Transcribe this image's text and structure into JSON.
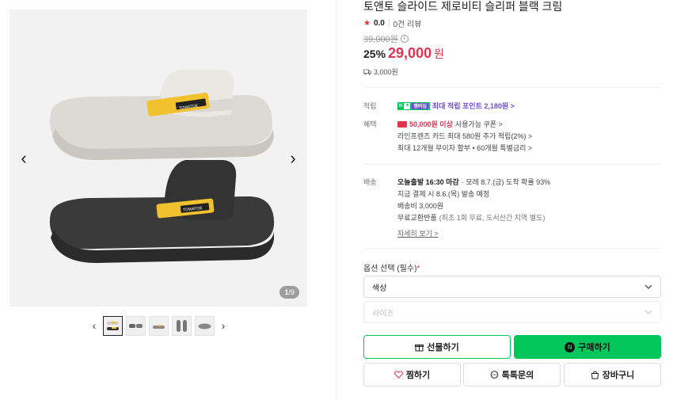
{
  "product": {
    "title": "토앤토 슬라이드 제로비티 슬리퍼 블랙 크림",
    "rating": "0.0",
    "review_count": "0건 리뷰",
    "original_price": "39,000원",
    "discount": "25%",
    "sale_price": "29,000",
    "currency": "원",
    "shipping_fee": "3,000원",
    "brand_mark": "TOWATOE"
  },
  "gallery": {
    "counter_current": "1",
    "counter_total": "/9",
    "prev_icon": "‹",
    "next_icon": "›"
  },
  "benefits": {
    "points_label": "적립",
    "npay_badge": "N",
    "npay_plus": "+",
    "membership_badge": "멤버십",
    "points_text": "최대 적립 포인트 2,180원 >",
    "perks_label": "혜택",
    "coupon_highlight": "50,000원 이상",
    "coupon_text": "사용가능 쿠폰 >",
    "card_text": "라인프렌즈 카드 최대 580원 추가 적립(2%) >",
    "installment_text": "최대 12개월 무이자 할부 • 60개월 특별금리 >"
  },
  "delivery": {
    "label": "배송",
    "dispatch_highlight": "오늘출발 16:30 마감",
    "arrival_text": "· 모레 8.7.(금) 도착 확률 93%",
    "pay_now_text": "지금 결제 시 8.6.(목) 발송 예정",
    "fee_text": "배송비 3,000원",
    "return_text": "무료교환반품",
    "return_note": "(최초 1회 무료, 도서산간 지역 별도)",
    "details_link": "자세히 보기 >"
  },
  "options": {
    "label": "옵션 선택 (필수)",
    "required_mark": "*",
    "color_placeholder": "색상",
    "size_placeholder": "사이즈"
  },
  "actions": {
    "gift": "선물하기",
    "buy": "구매하기",
    "buy_badge": "N",
    "wish": "찜하기",
    "talk": "톡톡문의",
    "cart": "장바구니"
  },
  "colors": {
    "accent_green": "#03c75a",
    "price_red": "#e2334f",
    "strap_yellow": "#f2c12e",
    "membership_purple": "#6c4ed9"
  }
}
